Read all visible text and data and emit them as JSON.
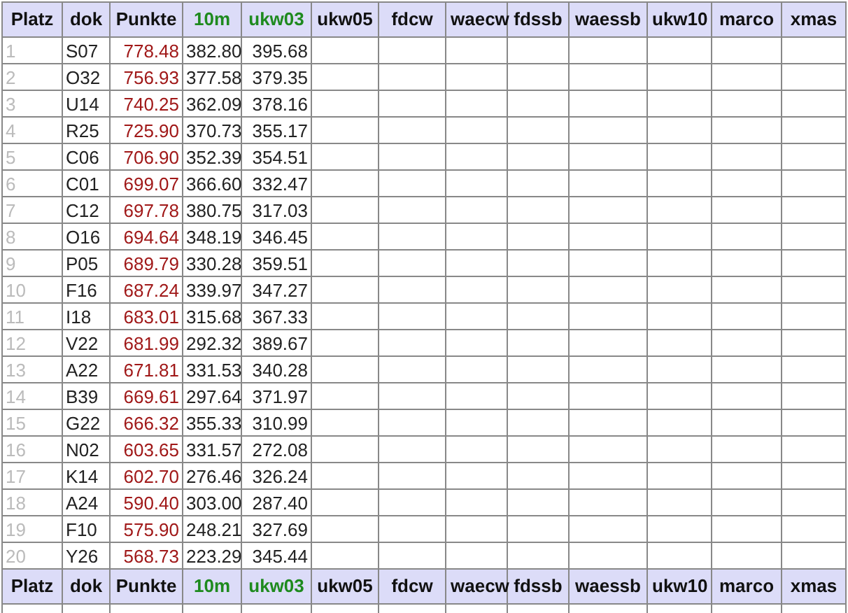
{
  "table": {
    "columns": [
      {
        "label": "Platz",
        "kind": "rank",
        "active": false
      },
      {
        "label": "dok",
        "kind": "dok",
        "active": false
      },
      {
        "label": "Punkte",
        "kind": "total",
        "active": false
      },
      {
        "label": "10m",
        "kind": "score",
        "active": true
      },
      {
        "label": "ukw03",
        "kind": "score",
        "active": true
      },
      {
        "label": "ukw05",
        "kind": "score",
        "active": false
      },
      {
        "label": "fdcw",
        "kind": "score",
        "active": false
      },
      {
        "label": "waecw",
        "kind": "score",
        "active": false
      },
      {
        "label": "fdssb",
        "kind": "score",
        "active": false
      },
      {
        "label": "waessb",
        "kind": "score",
        "active": false
      },
      {
        "label": "ukw10",
        "kind": "score",
        "active": false
      },
      {
        "label": "marco",
        "kind": "score",
        "active": false
      },
      {
        "label": "xmas",
        "kind": "score",
        "active": false
      }
    ],
    "rows": [
      {
        "platz": "1",
        "dok": "S07",
        "punkte": "778.48",
        "scores": [
          "382.80",
          "395.68"
        ]
      },
      {
        "platz": "2",
        "dok": "O32",
        "punkte": "756.93",
        "scores": [
          "377.58",
          "379.35"
        ]
      },
      {
        "platz": "3",
        "dok": "U14",
        "punkte": "740.25",
        "scores": [
          "362.09",
          "378.16"
        ]
      },
      {
        "platz": "4",
        "dok": "R25",
        "punkte": "725.90",
        "scores": [
          "370.73",
          "355.17"
        ]
      },
      {
        "platz": "5",
        "dok": "C06",
        "punkte": "706.90",
        "scores": [
          "352.39",
          "354.51"
        ]
      },
      {
        "platz": "6",
        "dok": "C01",
        "punkte": "699.07",
        "scores": [
          "366.60",
          "332.47"
        ]
      },
      {
        "platz": "7",
        "dok": "C12",
        "punkte": "697.78",
        "scores": [
          "380.75",
          "317.03"
        ]
      },
      {
        "platz": "8",
        "dok": "O16",
        "punkte": "694.64",
        "scores": [
          "348.19",
          "346.45"
        ]
      },
      {
        "platz": "9",
        "dok": "P05",
        "punkte": "689.79",
        "scores": [
          "330.28",
          "359.51"
        ]
      },
      {
        "platz": "10",
        "dok": "F16",
        "punkte": "687.24",
        "scores": [
          "339.97",
          "347.27"
        ]
      },
      {
        "platz": "11",
        "dok": "I18",
        "punkte": "683.01",
        "scores": [
          "315.68",
          "367.33"
        ]
      },
      {
        "platz": "12",
        "dok": "V22",
        "punkte": "681.99",
        "scores": [
          "292.32",
          "389.67"
        ]
      },
      {
        "platz": "13",
        "dok": "A22",
        "punkte": "671.81",
        "scores": [
          "331.53",
          "340.28"
        ]
      },
      {
        "platz": "14",
        "dok": "B39",
        "punkte": "669.61",
        "scores": [
          "297.64",
          "371.97"
        ]
      },
      {
        "platz": "15",
        "dok": "G22",
        "punkte": "666.32",
        "scores": [
          "355.33",
          "310.99"
        ]
      },
      {
        "platz": "16",
        "dok": "N02",
        "punkte": "603.65",
        "scores": [
          "331.57",
          "272.08"
        ]
      },
      {
        "platz": "17",
        "dok": "K14",
        "punkte": "602.70",
        "scores": [
          "276.46",
          "326.24"
        ]
      },
      {
        "platz": "18",
        "dok": "A24",
        "punkte": "590.40",
        "scores": [
          "303.00",
          "287.40"
        ]
      },
      {
        "platz": "19",
        "dok": "F10",
        "punkte": "575.90",
        "scores": [
          "248.21",
          "327.69"
        ]
      },
      {
        "platz": "20",
        "dok": "Y26",
        "punkte": "568.73",
        "scores": [
          "223.29",
          "345.44"
        ]
      }
    ],
    "footer_columns": [
      {
        "label": "Platz",
        "active": false
      },
      {
        "label": "dok",
        "active": false
      },
      {
        "label": "Punkte",
        "active": false
      },
      {
        "label": "10m",
        "active": true
      },
      {
        "label": "ukw03",
        "active": true
      },
      {
        "label": "ukw05",
        "active": false
      },
      {
        "label": "fdcw",
        "active": false
      },
      {
        "label": "waecw",
        "active": false
      },
      {
        "label": "fdssb",
        "active": false
      },
      {
        "label": "waessb",
        "active": false
      },
      {
        "label": "ukw10",
        "active": false
      },
      {
        "label": "marco",
        "active": false
      },
      {
        "label": "xmas",
        "active": false
      }
    ]
  }
}
